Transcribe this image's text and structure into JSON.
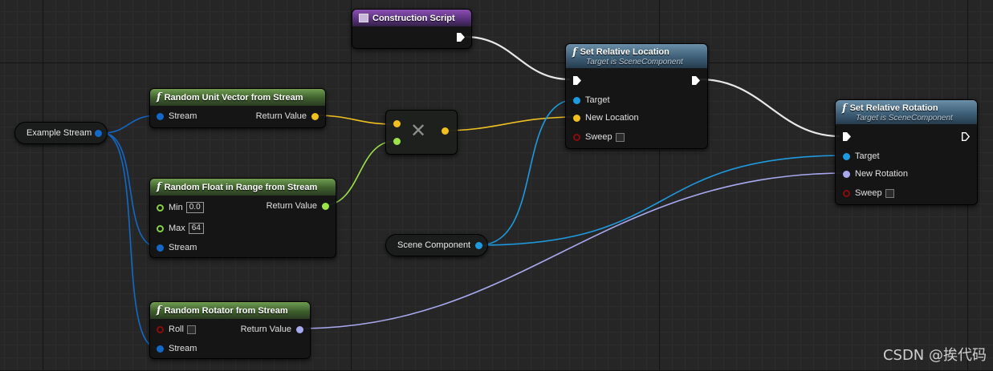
{
  "nodes": {
    "construction_script": {
      "title": "Construction Script"
    },
    "random_unit_vector": {
      "title": "Random Unit Vector from Stream",
      "pin_stream": "Stream",
      "pin_return": "Return Value"
    },
    "random_float": {
      "title": "Random Float in Range from Stream",
      "pin_min": "Min",
      "min_value": "0.0",
      "pin_max": "Max",
      "max_value": "64",
      "pin_stream": "Stream",
      "pin_return": "Return Value"
    },
    "random_rotator": {
      "title": "Random Rotator from Stream",
      "pin_roll": "Roll",
      "pin_stream": "Stream",
      "pin_return": "Return Value"
    },
    "set_relative_location": {
      "title": "Set Relative Location",
      "subtitle": "Target is SceneComponent",
      "pin_target": "Target",
      "pin_new_location": "New Location",
      "pin_sweep": "Sweep"
    },
    "set_relative_rotation": {
      "title": "Set Relative Rotation",
      "subtitle": "Target is SceneComponent",
      "pin_target": "Target",
      "pin_new_rotation": "New Rotation",
      "pin_sweep": "Sweep"
    },
    "example_stream": {
      "label": "Example Stream"
    },
    "scene_component": {
      "label": "Scene Component"
    }
  },
  "watermark": "CSDN @挨代码",
  "colors": {
    "exec_wire": "#ffffff",
    "vector_wire": "#f0c020",
    "float_wire": "#9ce24a",
    "object_wire": "#1e9ae0",
    "stream_wire": "#1468c8",
    "rotator_wire": "#a8aaf0"
  }
}
